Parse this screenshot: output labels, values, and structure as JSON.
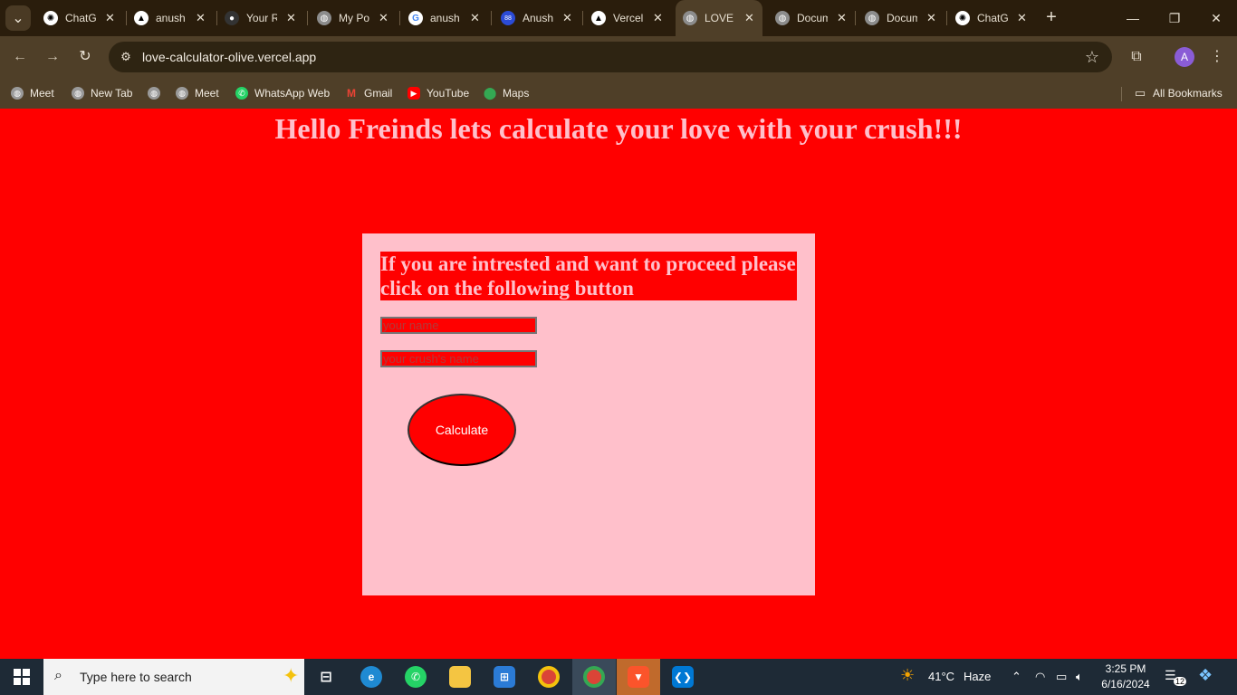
{
  "browser": {
    "tabs": [
      {
        "title": "ChatGPT",
        "favicon": "chatgpt-icon",
        "active": false
      },
      {
        "title": "anush",
        "favicon": "vercel-icon",
        "active": false
      },
      {
        "title": "Your Repositories",
        "favicon": "github-icon",
        "active": false
      },
      {
        "title": "My Portfolio",
        "favicon": "globe-icon",
        "active": false
      },
      {
        "title": "anush",
        "favicon": "google-icon",
        "active": false
      },
      {
        "title": "Anush",
        "favicon": "app-icon",
        "active": false
      },
      {
        "title": "Vercel",
        "favicon": "vercel-icon",
        "active": false
      },
      {
        "title": "LOVE",
        "favicon": "globe-icon",
        "active": true
      },
      {
        "title": "Document",
        "favicon": "globe-icon",
        "active": false
      },
      {
        "title": "Document",
        "favicon": "globe-icon",
        "active": false
      },
      {
        "title": "ChatGPT",
        "favicon": "chatgpt-icon",
        "active": false
      }
    ],
    "url": "love-calculator-olive.vercel.app",
    "profile_initial": "A",
    "bookmarks": [
      {
        "label": "Meet",
        "icon": "globe-icon"
      },
      {
        "label": "New Tab",
        "icon": "globe-icon"
      },
      {
        "label": "",
        "icon": "globe-icon"
      },
      {
        "label": "Meet",
        "icon": "globe-icon"
      },
      {
        "label": "WhatsApp Web",
        "icon": "whatsapp-icon"
      },
      {
        "label": "Gmail",
        "icon": "gmail-icon"
      },
      {
        "label": "YouTube",
        "icon": "youtube-icon"
      },
      {
        "label": "Maps",
        "icon": "maps-icon"
      }
    ],
    "all_bookmarks_label": "All Bookmarks"
  },
  "page": {
    "title": "Hello Freinds lets calculate your love with your crush!!!",
    "card_heading": "If you are intrested and want to proceed please click on the following button",
    "name_placeholder": "your name",
    "crush_placeholder": "your crush's name",
    "button_label": "Calculate"
  },
  "taskbar": {
    "search_placeholder": "Type here to search",
    "weather_temp": "41°C",
    "weather_desc": "Haze",
    "time": "3:25 PM",
    "date": "6/16/2024",
    "notifications_count": "12"
  },
  "colors": {
    "page_bg": "#ff0000",
    "card_bg": "#ffc0cb",
    "text_pink": "#ffc0cb"
  }
}
